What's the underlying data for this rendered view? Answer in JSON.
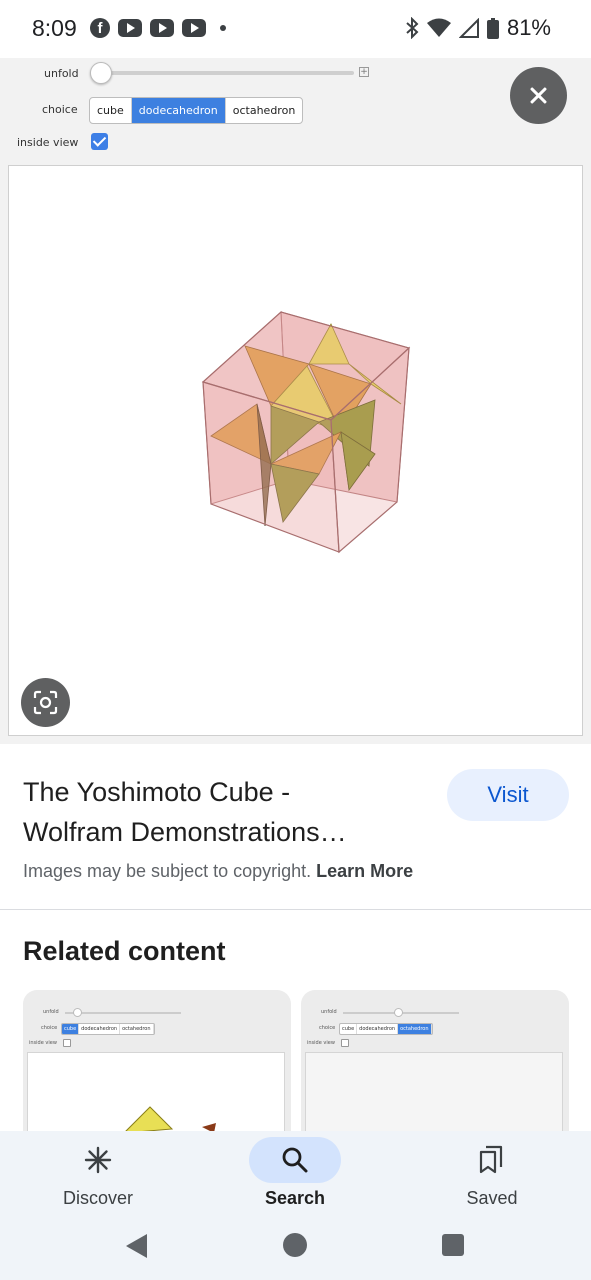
{
  "status_bar": {
    "time": "8:09",
    "battery": "81%",
    "notification_icons": [
      "facebook-icon",
      "youtube-icon",
      "youtube-icon",
      "youtube-icon",
      "dot-icon"
    ],
    "system_icons": [
      "bluetooth-icon",
      "wifi-icon",
      "signal-icon",
      "battery-icon"
    ]
  },
  "demo": {
    "unfold_label": "unfold",
    "unfold_level": 0,
    "choice_label": "choice",
    "choices": [
      "cube",
      "dodecahedron",
      "octahedron"
    ],
    "selected_choice": "dodecahedron",
    "inside_view_label": "inside view",
    "inside_view_checked": true,
    "colors": {
      "cube_face": "#e9a5a5",
      "orange_face": "#e0a040",
      "yellow_face": "#e8df55",
      "olive_face": "#8f9a2a",
      "control_accent": "#3d80e0"
    }
  },
  "result": {
    "title_line1": "The Yoshimoto Cube -",
    "title_line2": "Wolfram Demonstrations…",
    "visit_label": "Visit",
    "copyright_text": "Images may be subject to copyright.",
    "learn_more": "Learn More"
  },
  "related": {
    "title": "Related content",
    "thumbnails": [
      {
        "unfold_label": "unfold",
        "choice_label": "choice",
        "choices": [
          "cube",
          "dodecahedron",
          "octahedron"
        ],
        "selected_choice": "cube",
        "inside_view_label": "inside view"
      },
      {
        "unfold_label": "unfold",
        "choice_label": "choice",
        "choices": [
          "cube",
          "dodecahedron",
          "octahedron"
        ],
        "selected_choice": "octahedron",
        "inside_view_label": "inside view"
      }
    ]
  },
  "bottom_nav": {
    "items": [
      {
        "label": "Discover",
        "icon": "asterisk-icon"
      },
      {
        "label": "Search",
        "icon": "search-icon",
        "active": true
      },
      {
        "label": "Saved",
        "icon": "bookmarks-icon"
      }
    ]
  },
  "system_nav": [
    "back-button",
    "home-button",
    "recents-button"
  ]
}
